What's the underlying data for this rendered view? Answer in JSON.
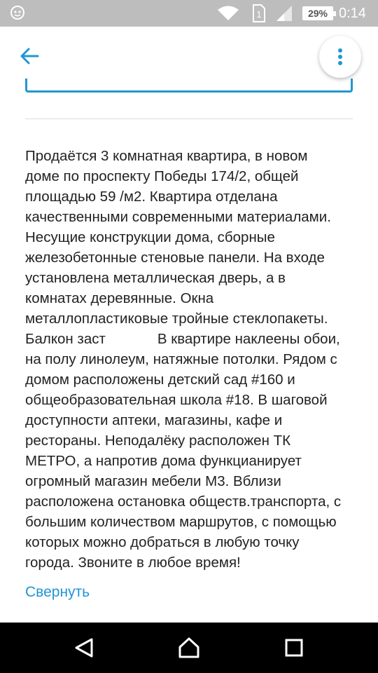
{
  "status_bar": {
    "battery": "29%",
    "time": "0:14",
    "sim_slot": "1"
  },
  "app_bar": {
    "back_icon": "arrow-left-icon",
    "menu_icon": "more-vertical-icon"
  },
  "listing": {
    "description": "Продаётся 3 комнатная квартира, в новом\nдоме по проспекту Победы 174/2, общей\nплощадью 59 /м2. Квартира отделана\nкачественными современными материалами.\nНесущие конструкции дома, сборные\nжелезобетонные стеновые панели. На входе\nустановлена металлическая дверь, а в\nкомнатах деревянные. Окна\nметаллопластиковые тройные стеклопакеты.\nБалкон заст             В квартире наклеены обои,\nна полу линолеум, натяжные потолки. Рядом с\nдомом расположены детский сад #160 и\nобщеобразовательная школа #18. В шаговой\nдоступности аптеки, магазины, кафе и\nрестораны. Неподалёку расположен ТК\nМЕТРО, а напротив дома функцианирует\nогромный магазин мебели М3. Вблизи\nрасположена остановка обществ.транспорта, с\nбольшим количеством маршрутов, с помощью\nкоторых можно добраться в любую точку\nгорода. Звоните в любое время!",
    "collapse_label": "Свернуть"
  },
  "colors": {
    "accent": "#2196d4",
    "status_bar": "#bdbdbd",
    "nav_bar": "#000000",
    "text": "#222222"
  }
}
